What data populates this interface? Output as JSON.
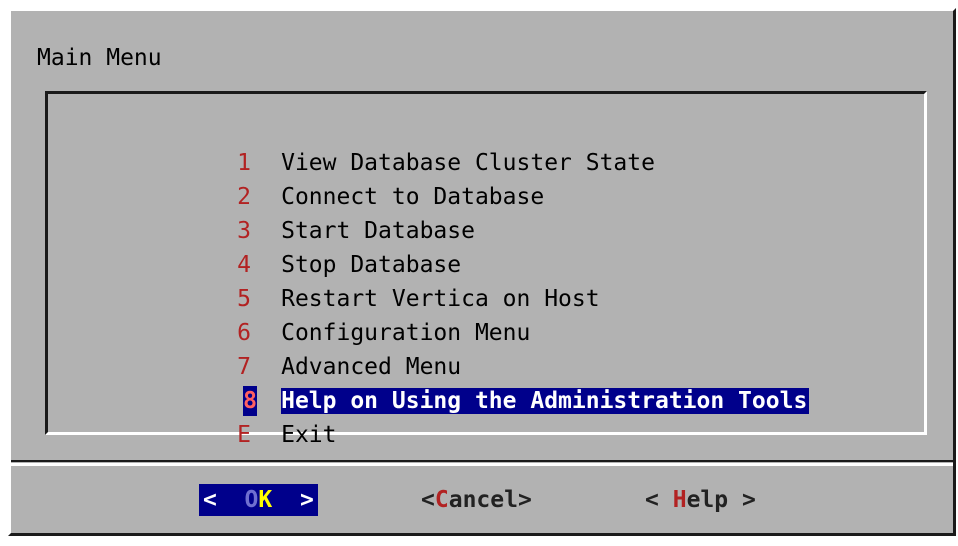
{
  "dialog": {
    "title": "Main Menu",
    "menu_items": [
      {
        "tag": "1",
        "label": "View Database Cluster State"
      },
      {
        "tag": "2",
        "label": "Connect to Database"
      },
      {
        "tag": "3",
        "label": "Start Database"
      },
      {
        "tag": "4",
        "label": "Stop Database"
      },
      {
        "tag": "5",
        "label": "Restart Vertica on Host"
      },
      {
        "tag": "6",
        "label": "Configuration Menu"
      },
      {
        "tag": "7",
        "label": "Advanced Menu"
      },
      {
        "tag": "8",
        "label": "Help on Using the Administration Tools",
        "selected": true
      },
      {
        "tag": "E",
        "label": "Exit"
      }
    ],
    "buttons": {
      "ok": {
        "open": "<  ",
        "pre": "O",
        "hot": "K",
        "close": "  >"
      },
      "cancel": {
        "open": "<",
        "hot": "C",
        "rest": "ancel",
        "close": ">"
      },
      "help": {
        "open": "< ",
        "hot": "H",
        "rest": "elp",
        "close": " >"
      }
    }
  },
  "colors": {
    "dialog_bg": "#b2b2b2",
    "selection_bg": "#00008b",
    "hotkey": "#b22222",
    "ok_hotkey": "#ffff00"
  }
}
